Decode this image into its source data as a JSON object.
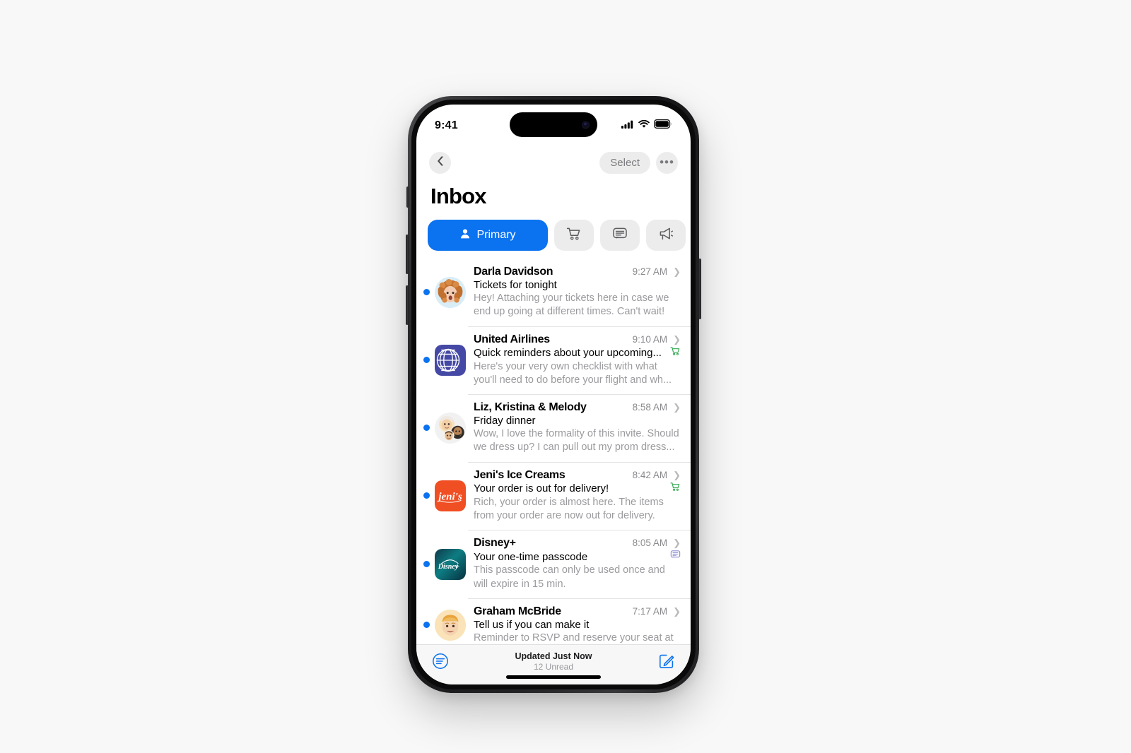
{
  "statusbar": {
    "time": "9:41",
    "icons": [
      "cellular-signal-icon",
      "wifi-icon",
      "battery-icon"
    ]
  },
  "navbar": {
    "back_icon": "chevron-left-icon",
    "select_label": "Select",
    "more_icon": "ellipsis-icon"
  },
  "header": {
    "title": "Inbox"
  },
  "categories": [
    {
      "label": "Primary",
      "icon": "person-icon",
      "active": true
    },
    {
      "label": "",
      "icon": "shopping-cart-icon",
      "active": false
    },
    {
      "label": "",
      "icon": "message-bubble-icon",
      "active": false
    },
    {
      "label": "",
      "icon": "megaphone-icon",
      "active": false
    }
  ],
  "emails": [
    {
      "sender": "Darla Davidson",
      "time": "9:27 AM",
      "subject": "Tickets for tonight",
      "preview": "Hey! Attaching your tickets here in case we end up going at different times. Can't wait!",
      "unread": true,
      "avatar": "memoji-darla",
      "badge": ""
    },
    {
      "sender": "United Airlines",
      "time": "9:10 AM",
      "subject": "Quick reminders about your upcoming...",
      "preview": "Here's your very own checklist with what you'll need to do before your flight and wh...",
      "unread": true,
      "avatar": "united-airlines-logo",
      "badge": "shopping-cart-badge"
    },
    {
      "sender": "Liz, Kristina & Melody",
      "time": "8:58 AM",
      "subject": "Friday dinner",
      "preview": "Wow, I love the formality of this invite. Should we dress up? I can pull out my prom dress...",
      "unread": true,
      "avatar": "memoji-group",
      "badge": ""
    },
    {
      "sender": "Jeni's Ice Creams",
      "time": "8:42 AM",
      "subject": "Your order is out for delivery!",
      "preview": "Rich, your order is almost here. The items from your order are now out for delivery.",
      "unread": true,
      "avatar": "jenis-ice-creams-logo",
      "badge": "shopping-cart-badge"
    },
    {
      "sender": "Disney+",
      "time": "8:05 AM",
      "subject": "Your one-time passcode",
      "preview": "This passcode can only be used once and will expire in 15 min.",
      "unread": true,
      "avatar": "disney-plus-logo",
      "badge": "message-bubble-badge"
    },
    {
      "sender": "Graham McBride",
      "time": "7:17 AM",
      "subject": "Tell us if you can make it",
      "preview": "Reminder to RSVP and reserve your seat at",
      "unread": true,
      "avatar": "memoji-graham",
      "badge": ""
    }
  ],
  "toolbar": {
    "filter_icon": "filter-lines-icon",
    "status_main": "Updated Just Now",
    "status_sub": "12 Unread",
    "compose_icon": "compose-pencil-icon"
  },
  "colors": {
    "accent_blue": "#0b72f0",
    "unread_dot": "#0b72f0",
    "badge_green": "#34a853",
    "badge_purple": "#8e8ed0",
    "pill_inactive": "#ececec",
    "page_background": "#f8f8f8",
    "screen_background": "#ffffff"
  }
}
